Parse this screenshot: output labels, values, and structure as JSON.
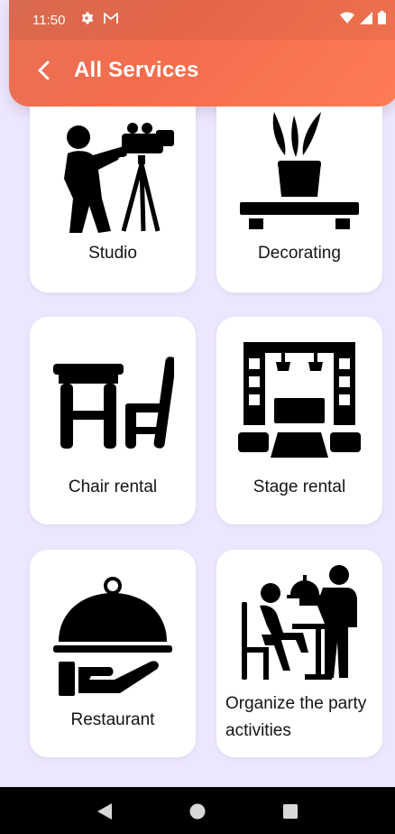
{
  "status_bar": {
    "time": "11:50",
    "left_icons": [
      "settings-icon",
      "gmail-icon"
    ],
    "right_icons": [
      "wifi-icon",
      "signal-icon",
      "battery-icon"
    ]
  },
  "app_bar": {
    "title": "All Services",
    "back_icon": "chevron-left-icon",
    "gradient": [
      "#e67155",
      "#ff7b55"
    ]
  },
  "background_color": "#ede6ff",
  "services": [
    {
      "label": "Studio",
      "icon": "videographer-icon"
    },
    {
      "label": "Decorating",
      "icon": "plant-shelf-icon"
    },
    {
      "label": "Chair rental",
      "icon": "table-chair-icon"
    },
    {
      "label": "Stage rental",
      "icon": "stage-icon"
    },
    {
      "label": "Restaurant",
      "icon": "cloche-icon"
    },
    {
      "label": "Organize the party activities",
      "icon": "waiter-icon"
    }
  ],
  "nav_bar": {
    "buttons": [
      "back-triangle-icon",
      "home-circle-icon",
      "recents-square-icon"
    ]
  }
}
